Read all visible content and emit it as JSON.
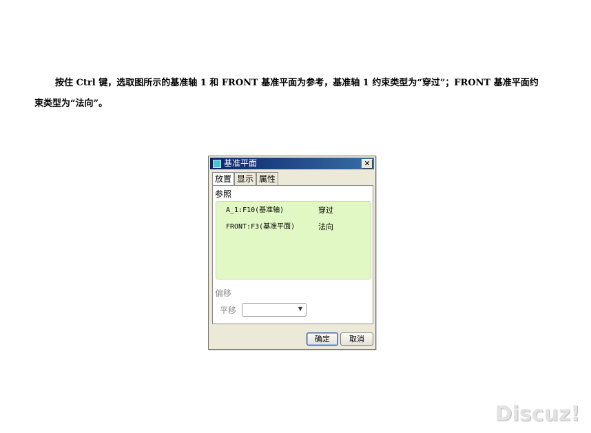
{
  "instruction": "按住 Ctrl 键，选取图所示的基准轴 1 和 FRONT 基准平面为参考，基准轴 1 约束类型为“穿过”；FRONT 基准平面约束类型为“法向”。",
  "dialog": {
    "title": "基准平面",
    "close_symbol": "✕",
    "tabs": [
      {
        "label": "放置"
      },
      {
        "label": "显示"
      },
      {
        "label": "属性"
      }
    ],
    "references_label": "参照",
    "references": [
      {
        "name": "A_1:F10(基准轴)",
        "type": "穿过"
      },
      {
        "name": "FRONT:F3(基准平面)",
        "type": "法向"
      }
    ],
    "offset_label": "偏移",
    "translate_label": "平移",
    "translate_value": "",
    "ok_label": "确定",
    "cancel_label": "取消"
  },
  "watermark": "Discuz!"
}
